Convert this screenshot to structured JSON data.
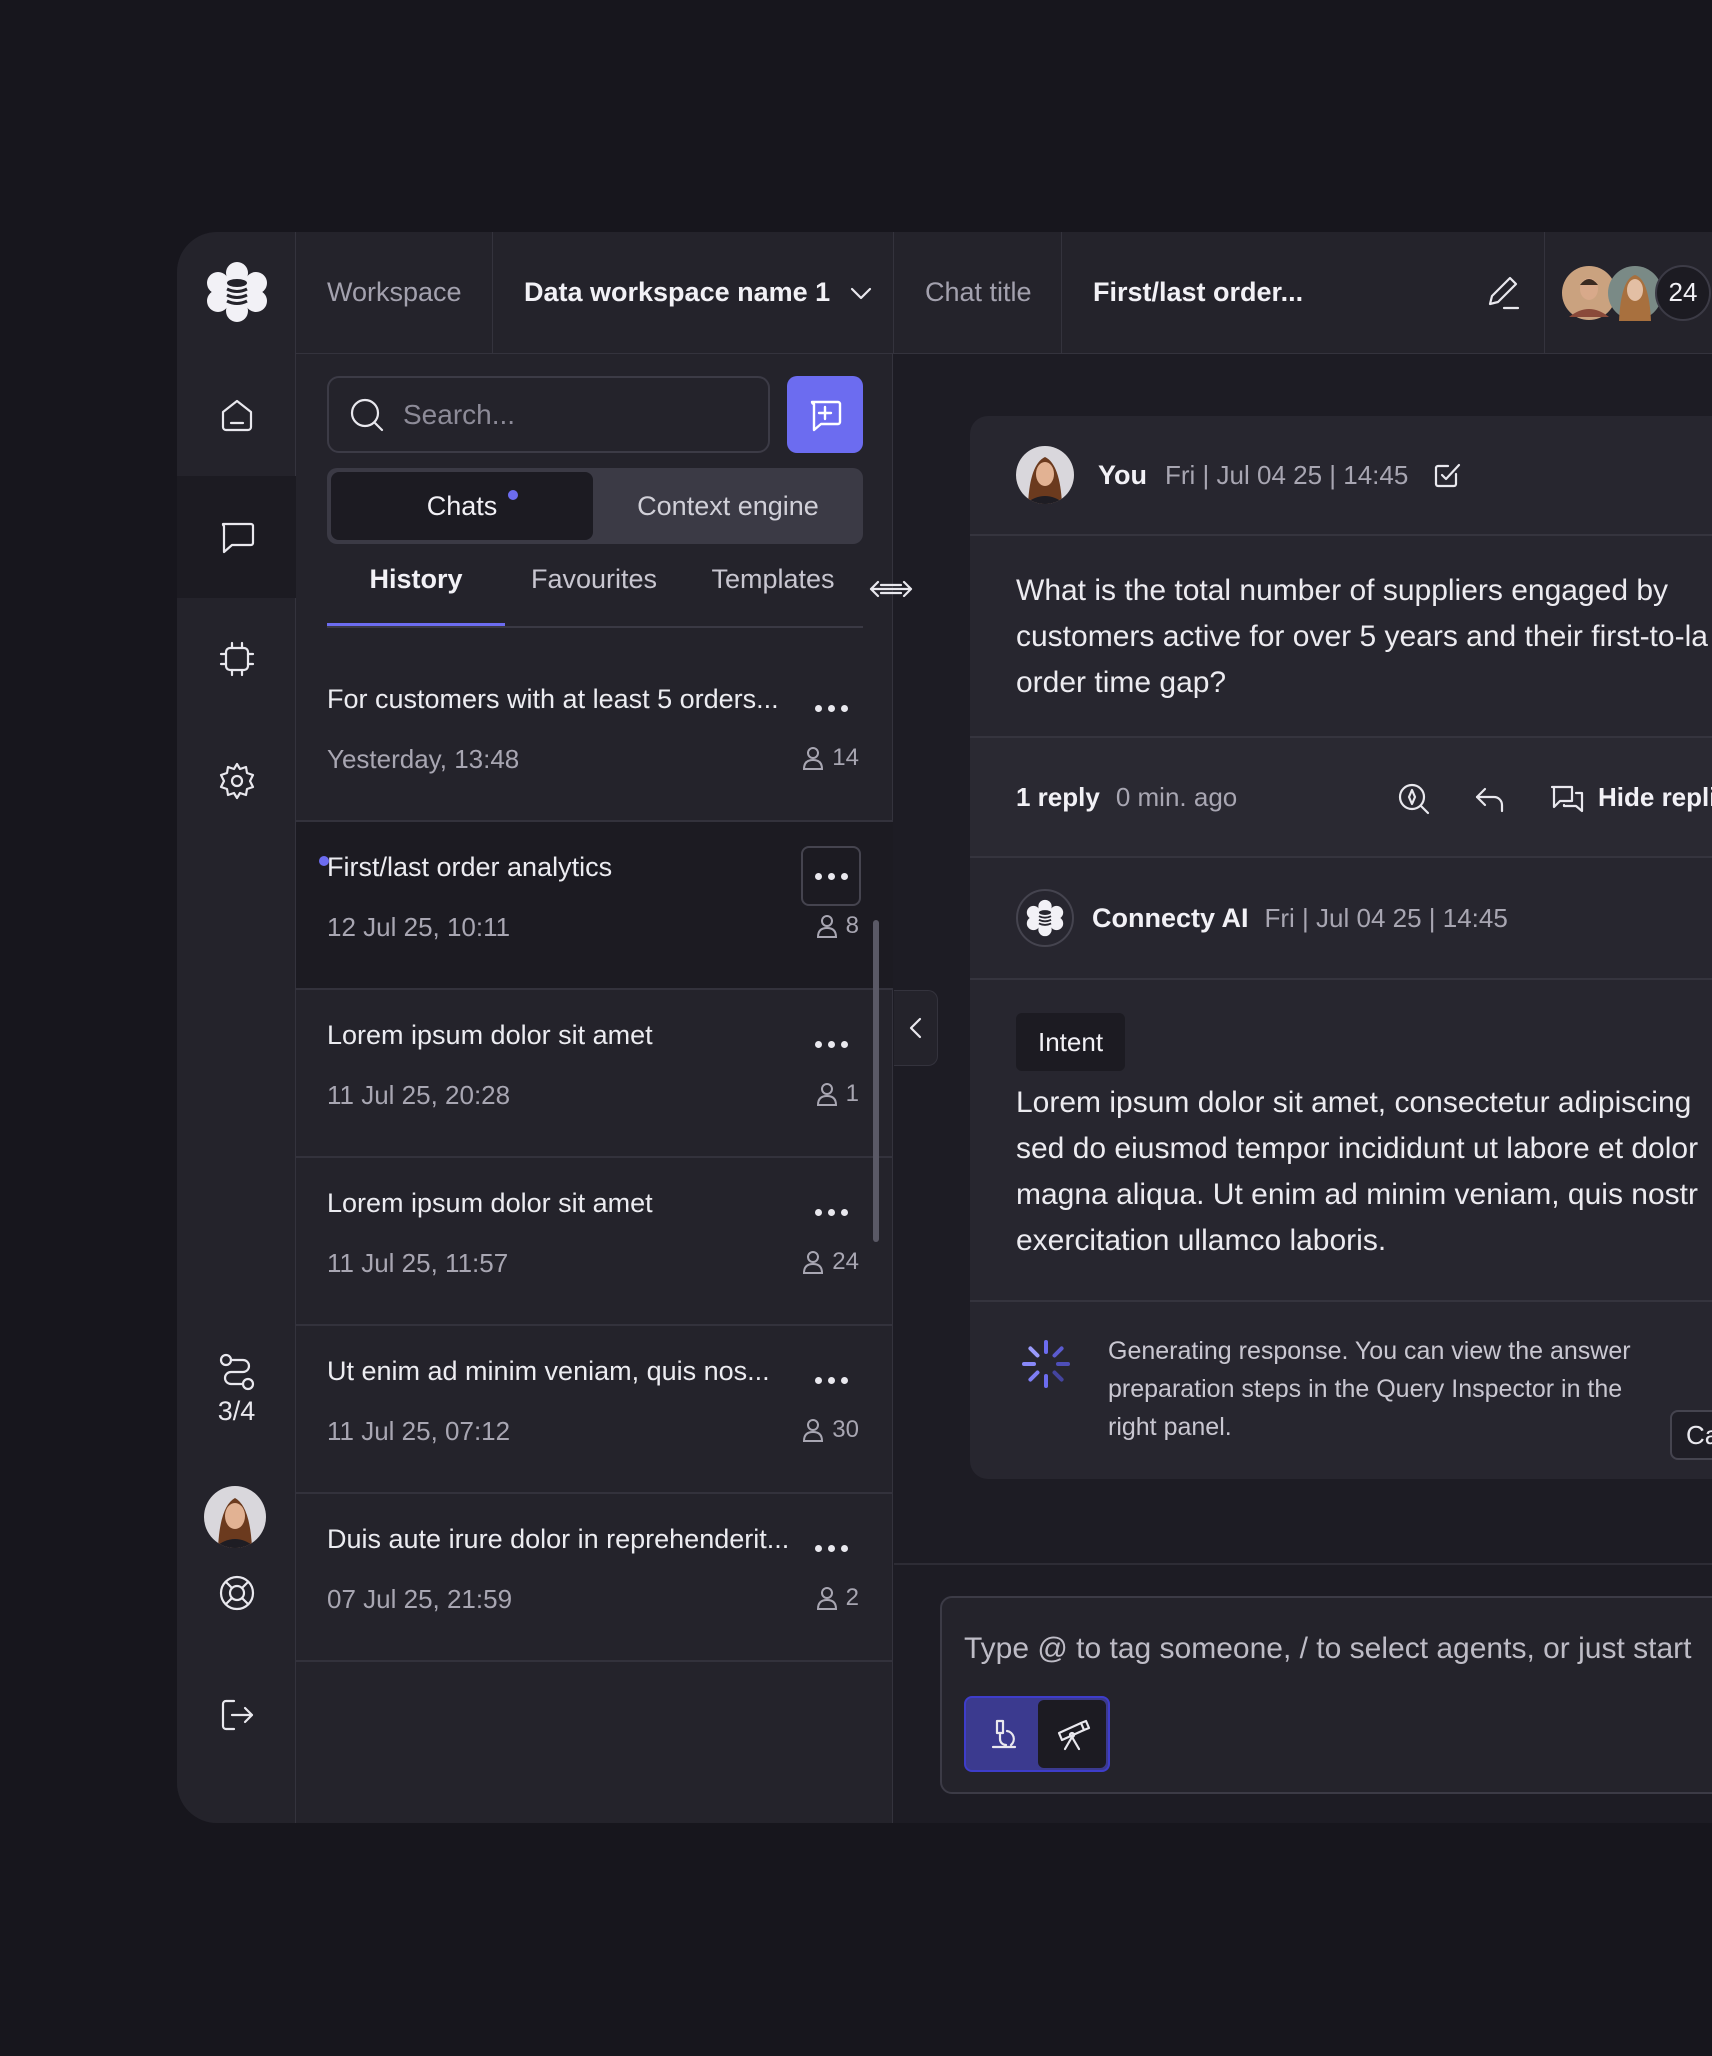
{
  "topbar": {
    "workspace_label": "Workspace",
    "workspace_name": "Data workspace name 1",
    "chat_title_label": "Chat title",
    "chat_title_value": "First/last order...",
    "participants_count": "24"
  },
  "rail": {
    "steps_label": "3/4"
  },
  "list": {
    "search_placeholder": "Search...",
    "segments": {
      "chats": "Chats",
      "context": "Context engine"
    },
    "tabs": {
      "history": "History",
      "favourites": "Favourites",
      "templates": "Templates"
    },
    "items": [
      {
        "title": "For customers with at least 5 orders...",
        "date": "Yesterday, 13:48",
        "users": "14"
      },
      {
        "title": "First/last order analytics",
        "date": "12 Jul 25, 10:11",
        "users": "8"
      },
      {
        "title": "Lorem ipsum dolor sit amet",
        "date": "11 Jul 25, 20:28",
        "users": "1"
      },
      {
        "title": "Lorem ipsum dolor sit amet",
        "date": "11 Jul 25, 11:57",
        "users": "24"
      },
      {
        "title": "Ut enim ad minim veniam, quis nos...",
        "date": "11 Jul 25, 07:12",
        "users": "30"
      },
      {
        "title": "Duis aute irure dolor in reprehenderit...",
        "date": "07 Jul 25, 21:59",
        "users": "2"
      }
    ]
  },
  "conversation": {
    "user_name": "You",
    "user_meta": "Fri | Jul 04 25 | 14:45",
    "question_lines": [
      "What is the total number of suppliers engaged by",
      "customers active for over 5 years and their first-to-la",
      "order time gap?"
    ],
    "replies_count": "1 reply",
    "replies_time": "0 min. ago",
    "hide_replies": "Hide repli",
    "ai_name": "Connecty AI",
    "ai_meta": "Fri | Jul 04 25 | 14:45",
    "intent_label": "Intent",
    "ai_lines": [
      "Lorem ipsum dolor sit amet, consectetur adipiscing",
      "sed do eiusmod tempor incididunt ut labore et dolor",
      "magna aliqua. Ut enim ad minim veniam, quis nostr",
      "exercitation ullamco laboris."
    ],
    "generating_text": "Generating response. You can view the answer preparation steps in the Query Inspector in the right panel.",
    "cancel_label": "Car"
  },
  "composer": {
    "placeholder": "Type @ to tag someone, / to select agents, or just start"
  },
  "colors": {
    "accent": "#6c6cf0",
    "background": "#17161d",
    "panel": "#24232b"
  }
}
